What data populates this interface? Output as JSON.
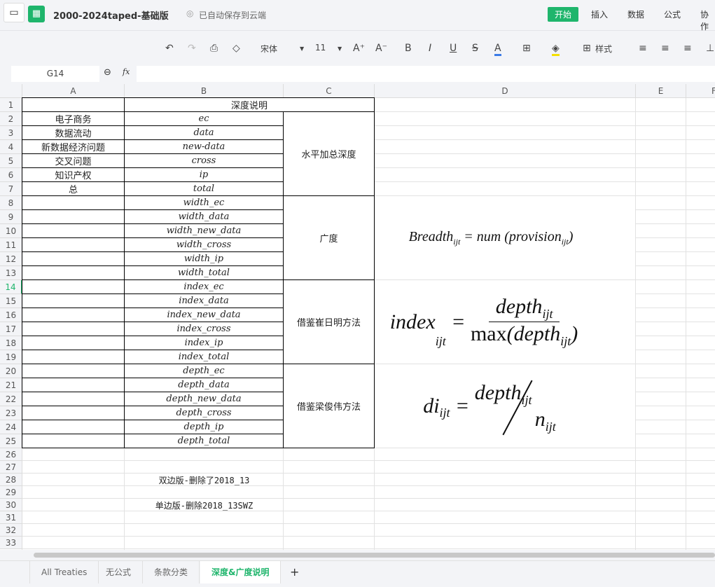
{
  "app": {
    "title": "2000-2024taped-基础版",
    "save_status": "已自动保存到云端",
    "menu": [
      "开始",
      "插入",
      "数据",
      "公式",
      "协作"
    ],
    "accent": "#1fb56c"
  },
  "toolbar": {
    "font": "宋体",
    "size": "11",
    "style_label": "样式"
  },
  "formula_bar": {
    "cell_ref": "G14",
    "fx": "fx",
    "value": ""
  },
  "columns": [
    "A",
    "B",
    "C",
    "D",
    "E",
    "F"
  ],
  "rows": 33,
  "cells": {
    "B1": "深度说明",
    "A2": "电子商务",
    "A3": "数据流动",
    "A4": "新数据经济问题",
    "A5": "交叉问题",
    "A6": "知识产权",
    "A7": "总",
    "B2": "ec",
    "B3": "data",
    "B4": "new-data",
    "B5": "cross",
    "B6": "ip",
    "B7": "total",
    "B8": "width_ec",
    "B9": "width_data",
    "B10": "width_new_data",
    "B11": "width_cross",
    "B12": "width_ip",
    "B13": "width_total",
    "B14": "index_ec",
    "B15": "index_data",
    "B16": "index_new_data",
    "B17": "index_cross",
    "B18": "index_ip",
    "B19": "index_total",
    "B20": "depth_ec",
    "B21": "depth_data",
    "B22": "depth_new_data",
    "B23": "depth_cross",
    "B24": "depth_ip",
    "B25": "depth_total",
    "C2": "水平加总深度",
    "C8": "广度",
    "C14": "借鉴崔日明方法",
    "C20": "借鉴梁俊伟方法",
    "B28": "双边版-删除了2018_13",
    "B30": "单边版-删除2018_13SWZ"
  },
  "formulas": {
    "breadth": {
      "lhs": "Breadth",
      "sub": "ijt",
      "rhs": "= num  (provision",
      "rsub": "ijt"
    },
    "index": {
      "lhs": "index",
      "sub": "ijt",
      "num": "depth",
      "den_fn": "max",
      "den": "depth"
    },
    "di": {
      "lhs": "di",
      "sub": "ijt",
      "num": "depth",
      "den": "n"
    }
  },
  "sheets": [
    "All Treaties",
    "无公式",
    "条款分类",
    "深度&广度说明"
  ],
  "active_sheet": 3
}
